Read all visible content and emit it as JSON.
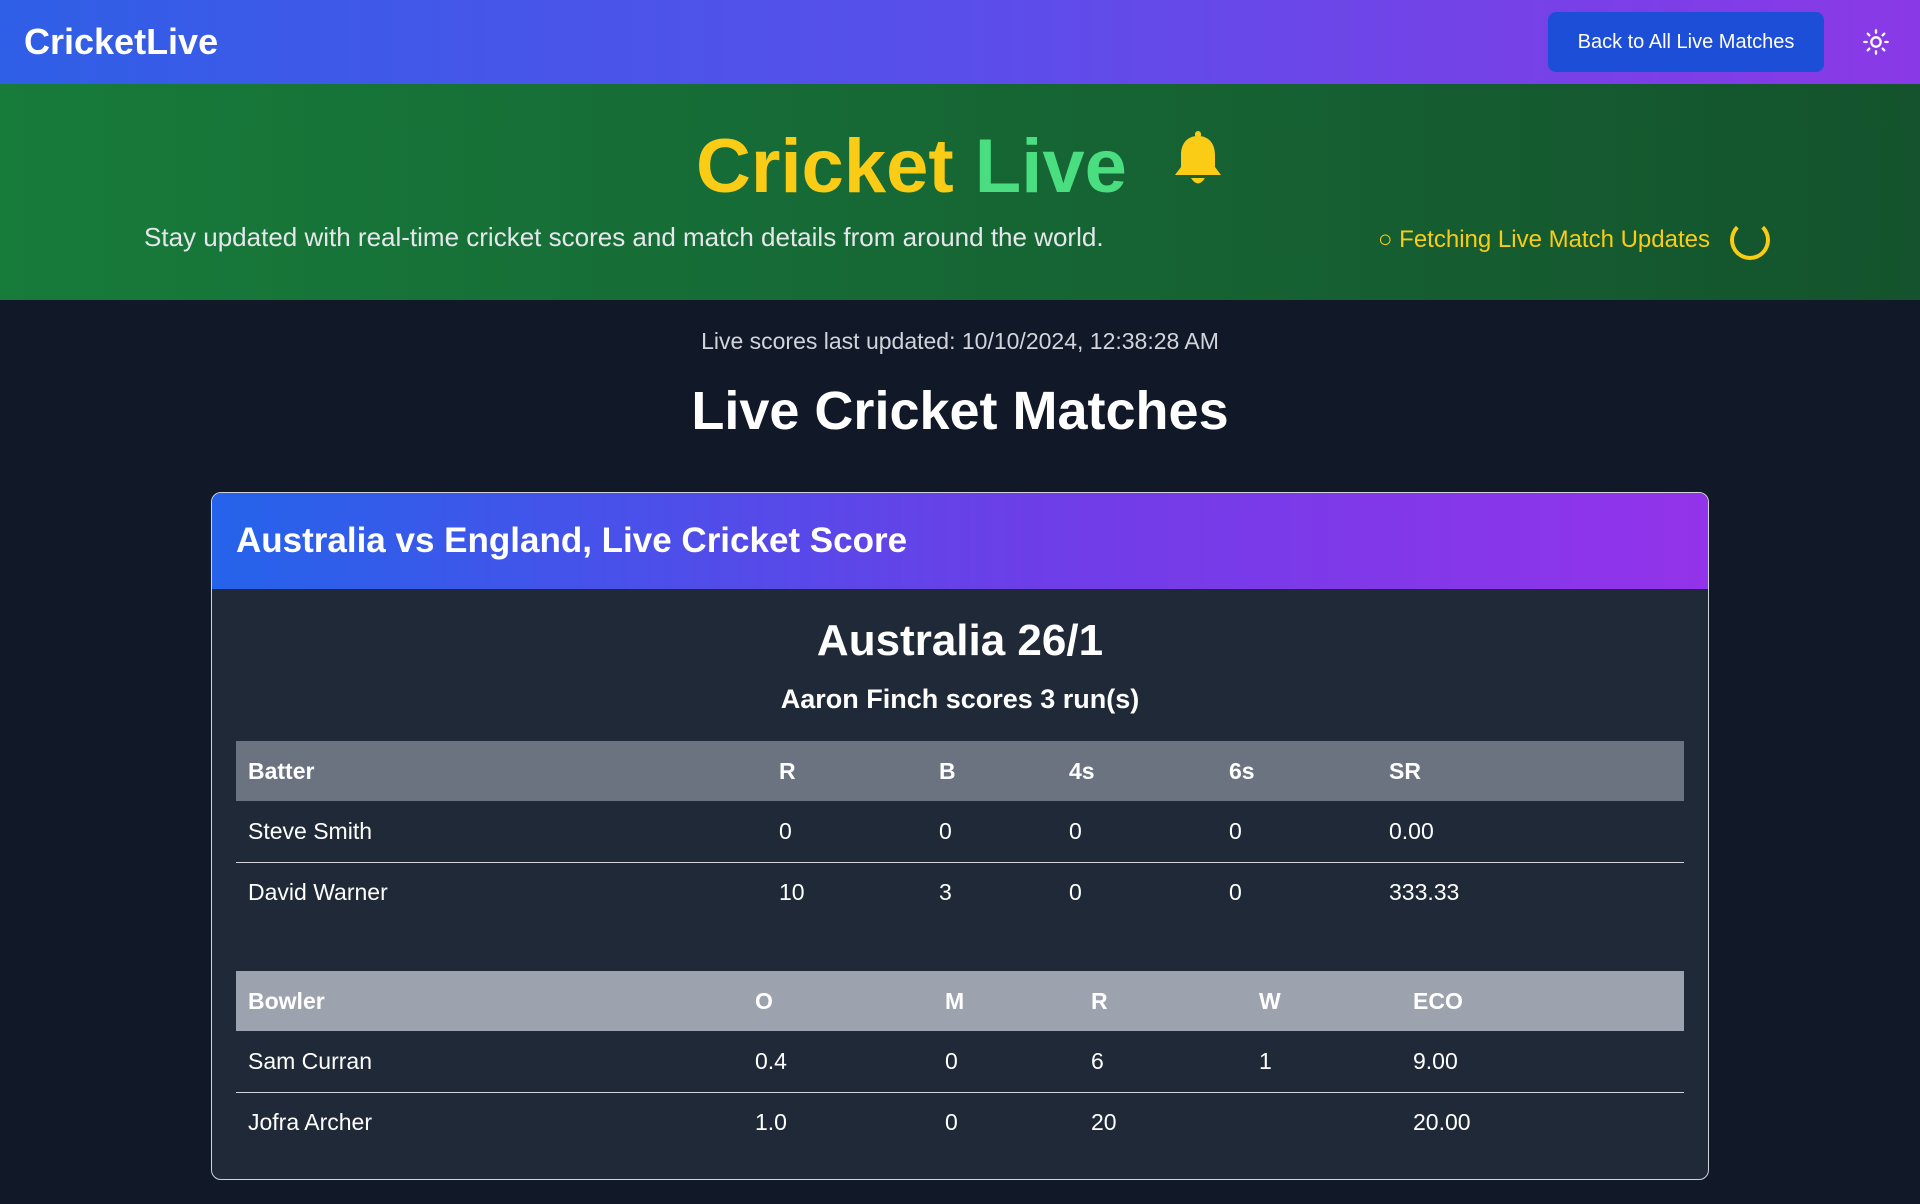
{
  "nav": {
    "brand": "CricketLive",
    "back_label": "Back to All Live Matches",
    "theme_icon": "sun-icon"
  },
  "hero": {
    "title_part1": "Cricket",
    "title_part2": "Live",
    "bell_icon": "bell-icon",
    "subtitle": "Stay updated with real-time cricket scores and match details from around the world.",
    "fetching": "○ Fetching Live Match Updates"
  },
  "main": {
    "last_updated": "Live scores last updated: 10/10/2024, 12:38:28 AM",
    "title": "Live Cricket Matches"
  },
  "match": {
    "header": "Australia vs England, Live Cricket Score",
    "score": "Australia 26/1",
    "commentary": "Aaron Finch scores 3 run(s)",
    "batting": {
      "headers": [
        "Batter",
        "R",
        "B",
        "4s",
        "6s",
        "SR"
      ],
      "rows": [
        [
          "Steve Smith",
          "0",
          "0",
          "0",
          "0",
          "0.00"
        ],
        [
          "David Warner",
          "10",
          "3",
          "0",
          "0",
          "333.33"
        ]
      ]
    },
    "bowling": {
      "headers": [
        "Bowler",
        "O",
        "M",
        "R",
        "W",
        "ECO"
      ],
      "rows": [
        [
          "Sam Curran",
          "0.4",
          "0",
          "6",
          "1",
          "9.00"
        ],
        [
          "Jofra Archer",
          "1.0",
          "0",
          "20",
          "",
          "20.00"
        ]
      ]
    }
  },
  "colors": {
    "nav_gradient_start": "#2f5fe6",
    "nav_gradient_end": "#8a39e6",
    "hero_bg": "#166534",
    "title_yellow": "#facc15",
    "title_green": "#4ade80",
    "page_bg": "#111827",
    "card_bg": "#1f2937",
    "button_blue": "#1d4ed8"
  }
}
